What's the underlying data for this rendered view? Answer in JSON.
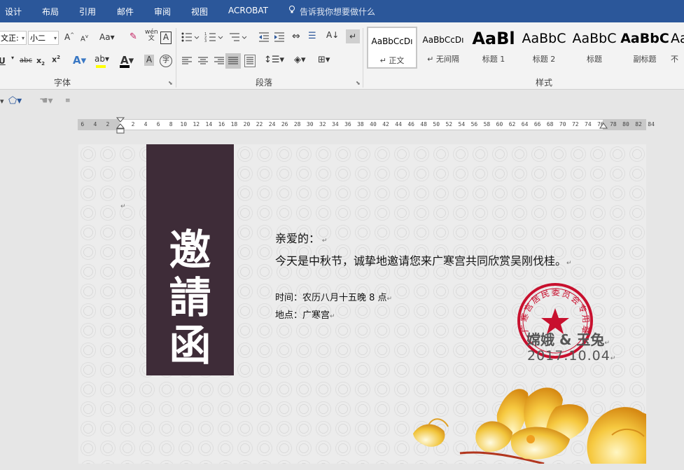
{
  "tabs": [
    {
      "label": "设计"
    },
    {
      "label": "布局"
    },
    {
      "label": "引用"
    },
    {
      "label": "邮件"
    },
    {
      "label": "审阅"
    },
    {
      "label": "视图"
    },
    {
      "label": "ACROBAT"
    }
  ],
  "tell_me": "告诉我你想要做什么",
  "font": {
    "name": "(中文正文)",
    "name_visible": "文正:",
    "size": "小二",
    "group_label": "字体"
  },
  "paragraph": {
    "group_label": "段落"
  },
  "styles": {
    "group_label": "样式",
    "items": [
      {
        "sample": "AaBbCcDı",
        "name": "正文"
      },
      {
        "sample": "AaBbCcDı",
        "name": "无间隔"
      },
      {
        "sample": "AaBl",
        "name": "标题 1"
      },
      {
        "sample": "AaBbC",
        "name": "标题 2"
      },
      {
        "sample": "AaBbC",
        "name": "标题"
      },
      {
        "sample": "AaBbC",
        "name": "副标题"
      },
      {
        "sample": "AaBbC",
        "name": "不"
      }
    ]
  },
  "ruler": {
    "left_numbers": [
      "6",
      "4",
      "2"
    ],
    "right_numbers": [
      "2",
      "4",
      "6",
      "8",
      "10",
      "12",
      "14",
      "16",
      "18",
      "20",
      "22",
      "24",
      "26",
      "28",
      "30",
      "32",
      "34",
      "36",
      "38",
      "40",
      "42",
      "44",
      "46",
      "48",
      "50",
      "52",
      "54",
      "56",
      "58",
      "60",
      "62",
      "64",
      "66",
      "68",
      "70",
      "72",
      "74",
      "76",
      "78",
      "80",
      "82",
      "84"
    ]
  },
  "document": {
    "banner_chars": [
      "邀",
      "請",
      "函"
    ],
    "greeting": "亲爱的：",
    "body": "今天是中秋节，诚挚地邀请您来广寒宫共同欣赏吴刚伐桂。",
    "time": "时间：农历八月十五晚 8 点",
    "place": "地点：广寒宫",
    "signature": "嫦娥 & 玉兔",
    "date": "2017.10.04",
    "seal_text": "广寒宫居民委员会专用章"
  },
  "colors": {
    "tabbar": "#2b579a",
    "banner": "#3e2c38",
    "seal": "#c8102e"
  }
}
